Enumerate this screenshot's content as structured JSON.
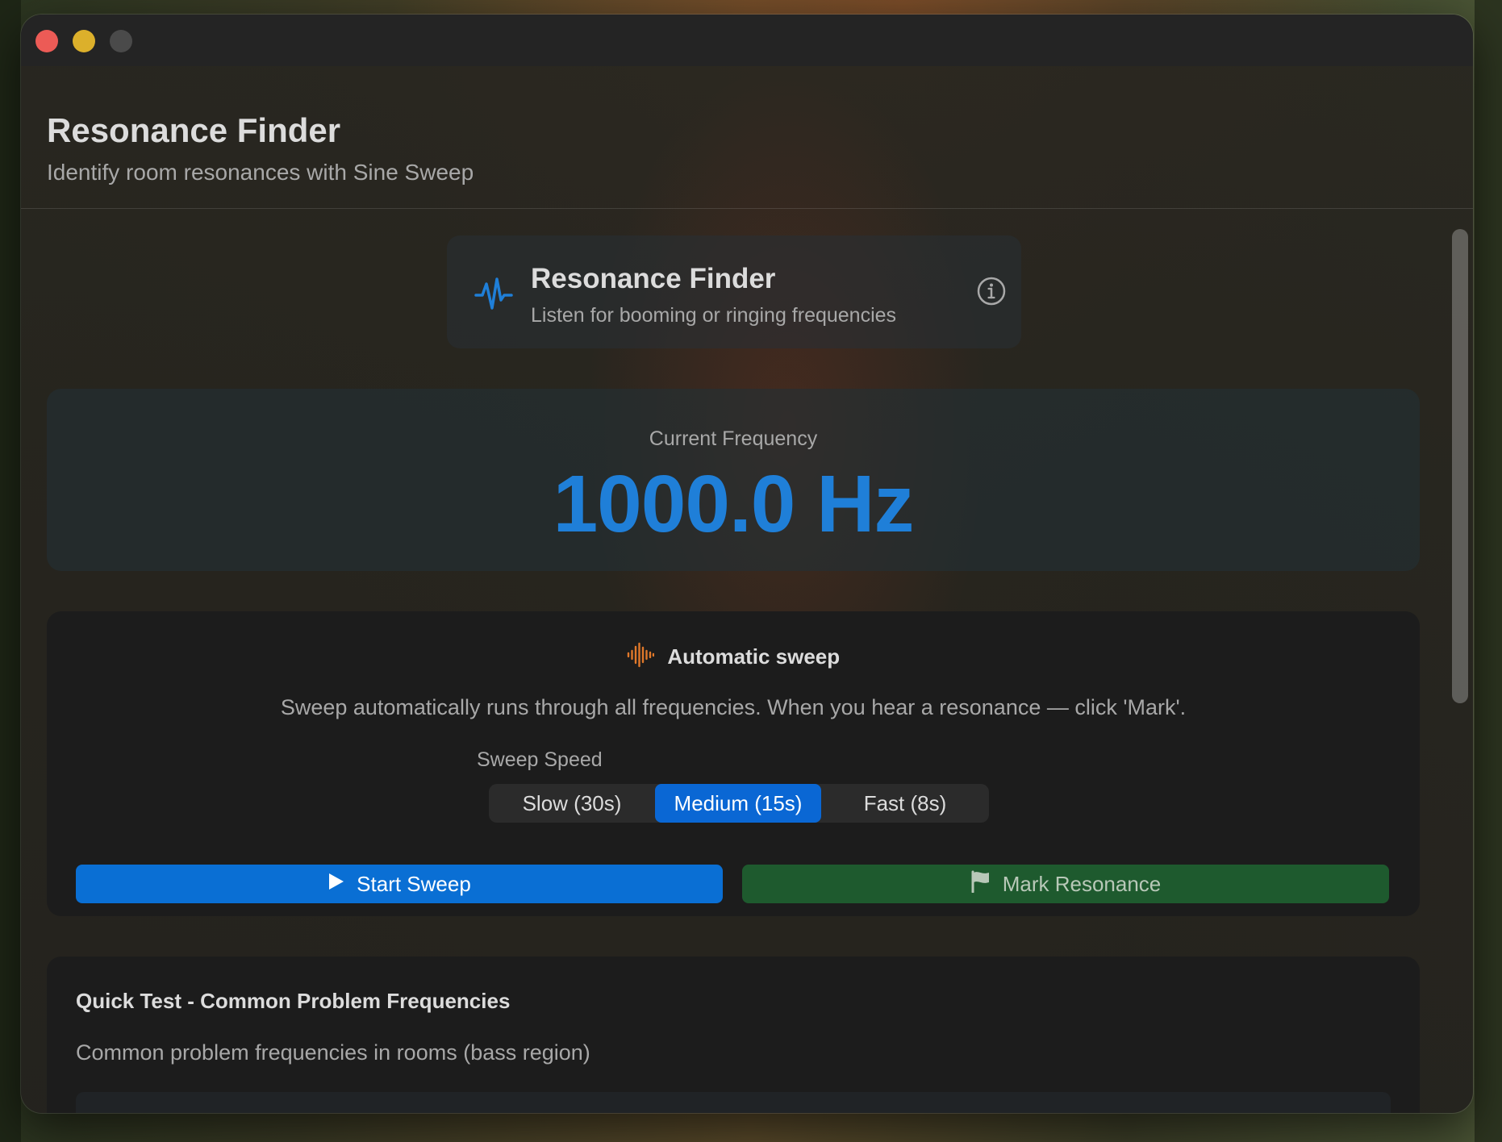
{
  "window": {
    "controls": [
      "close",
      "minimize",
      "maximize"
    ]
  },
  "header": {
    "title": "Resonance Finder",
    "subtitle": "Identify room resonances with Sine Sweep"
  },
  "info_card": {
    "icon": "waveform-path-icon",
    "title": "Resonance Finder",
    "subtitle": "Listen for booming or ringing frequencies",
    "info_icon": "info-circle-icon"
  },
  "frequency": {
    "label": "Current Frequency",
    "value": "1000.0 Hz"
  },
  "sweep": {
    "icon": "waveform-icon",
    "title": "Automatic sweep",
    "description": "Sweep automatically runs through all frequencies. When you hear a resonance — click 'Mark'.",
    "speed_label": "Sweep Speed",
    "speed_options": [
      "Slow (30s)",
      "Medium (15s)",
      "Fast (8s)"
    ],
    "selected_speed": "Medium (15s)",
    "start_label": "Start Sweep",
    "mark_label": "Mark Resonance"
  },
  "quick_test": {
    "title": "Quick Test - Common Problem Frequencies",
    "description": "Common problem frequencies in rooms (bass region)"
  },
  "colors": {
    "accent": "#0a6fd4",
    "frequency_text": "#1f7fd8",
    "mark_button": "#1e5a2e",
    "sweep_icon": "#e0782a"
  }
}
